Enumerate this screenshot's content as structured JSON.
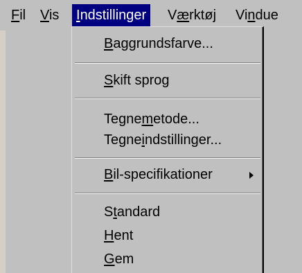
{
  "menubar": {
    "items": [
      {
        "pre": "",
        "key": "F",
        "post": "il"
      },
      {
        "pre": "",
        "key": "V",
        "post": "is"
      },
      {
        "pre": "",
        "key": "I",
        "post": "ndstillinger"
      },
      {
        "pre": "V",
        "key": "æ",
        "post": "rktøj"
      },
      {
        "pre": "Vi",
        "key": "n",
        "post": "due"
      }
    ]
  },
  "dropdown": {
    "items": [
      {
        "pre": "",
        "key": "B",
        "post": "aggrundsfarve..."
      },
      {
        "pre": "",
        "key": "S",
        "post": "kift sprog"
      },
      {
        "pre": "Tegne",
        "key": "m",
        "post": "etode..."
      },
      {
        "pre": "Tegne",
        "key": "i",
        "post": "ndstillinger..."
      },
      {
        "pre": "",
        "key": "B",
        "post": "il-specifikationer"
      },
      {
        "pre": "S",
        "key": "t",
        "post": "andard"
      },
      {
        "pre": "",
        "key": "H",
        "post": "ent"
      },
      {
        "pre": "",
        "key": "G",
        "post": "em"
      }
    ]
  },
  "colors": {
    "menu_bg": "#c0c0c0",
    "highlight": "#000080",
    "highlight_text": "#ffffff"
  }
}
